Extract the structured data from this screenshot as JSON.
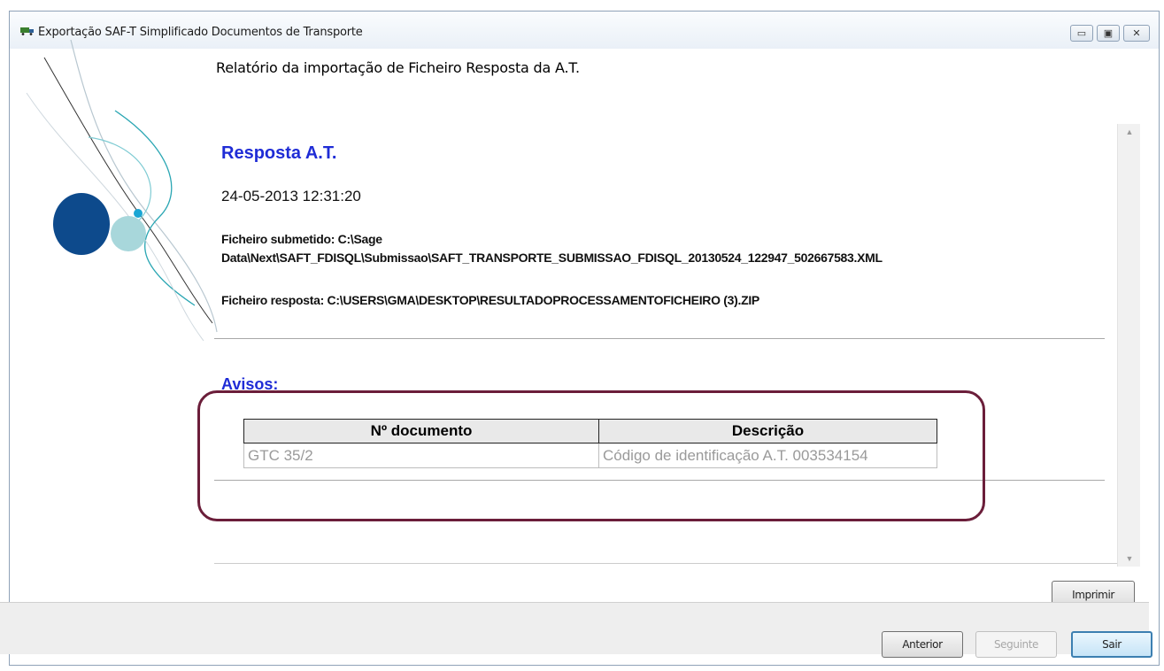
{
  "window": {
    "title": "Exportação SAF-T Simplificado Documentos de Transporte",
    "icon": "truck-icon",
    "controls": {
      "minimize": "▭",
      "maximize": "▣",
      "close": "✕"
    }
  },
  "report": {
    "header": "Relatório da importação de Ficheiro Resposta da A.T.",
    "response_title": "Resposta A.T.",
    "timestamp": "24-05-2013 12:31:20",
    "submitted_line1": "Ficheiro submetido: C:\\Sage",
    "submitted_line2": "Data\\Next\\SAFT_FDISQL\\Submissao\\SAFT_TRANSPORTE_SUBMISSAO_FDISQL_20130524_122947_502667583.XML",
    "response_file": "Ficheiro resposta: C:\\USERS\\GMA\\DESKTOP\\RESULTADOPROCESSAMENTOFICHEIRO (3).ZIP",
    "warnings_title": "Avisos:",
    "table": {
      "headers": [
        "Nº documento",
        "Descrição"
      ],
      "rows": [
        [
          "GTC 35/2",
          "Código de identificação A.T. 003534154"
        ]
      ]
    }
  },
  "buttons": {
    "print": "Imprimir",
    "previous": "Anterior",
    "next": "Seguinte",
    "exit": "Sair"
  },
  "colors": {
    "title_blue": "#1f2cd6",
    "highlight_border": "#6b1e3a"
  }
}
